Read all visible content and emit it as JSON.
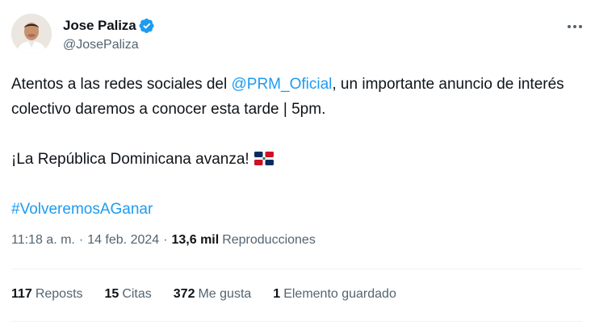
{
  "author": {
    "display_name": "Jose Paliza",
    "handle": "@JosePaliza",
    "verified": true,
    "avatar_icon": "profile-photo"
  },
  "tweet": {
    "line1_prefix": "Atentos a las redes sociales del ",
    "mention": "@PRM_Oficial",
    "line1_suffix": ", un importante anuncio de interés colectivo daremos a conocer esta tarde | 5pm.",
    "line2": "¡La República Dominicana avanza!",
    "flag_icon": "dominican-republic-flag-icon",
    "hashtag": "#VolveremosAGanar"
  },
  "meta": {
    "time": "11:18 a. m.",
    "date": "14 feb. 2024",
    "separator": "·",
    "views": "13,6 mil",
    "views_label": "Reproducciones"
  },
  "stats": {
    "reposts_count": "117",
    "reposts_label": "Reposts",
    "quotes_count": "15",
    "quotes_label": "Citas",
    "likes_count": "372",
    "likes_label": "Me gusta",
    "bookmarks_count": "1",
    "bookmarks_label": "Elemento guardado"
  },
  "colors": {
    "link": "#1d9bf0",
    "secondary_text": "#536471",
    "primary_text": "#0f1419",
    "divider": "#eff3f4"
  }
}
